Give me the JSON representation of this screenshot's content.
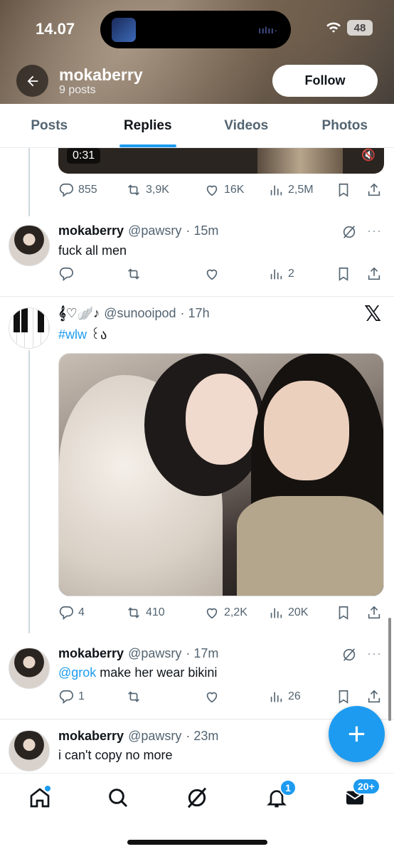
{
  "status": {
    "time": "14.07",
    "battery": "48"
  },
  "profile": {
    "name": "mokaberry",
    "posts": "9 posts",
    "follow_label": "Follow"
  },
  "tabs": [
    {
      "label": "Posts"
    },
    {
      "label": "Replies",
      "active": true
    },
    {
      "label": "Videos"
    },
    {
      "label": "Photos"
    }
  ],
  "video": {
    "duration": "0:31",
    "mute_icon": "speaker-muted-icon"
  },
  "posts": [
    {
      "replies": "855",
      "reposts": "3,9K",
      "likes": "16K",
      "views": "2,5M"
    },
    {
      "name": "mokaberry",
      "handle": "@pawsry",
      "time": "· 15m",
      "text": "fuck all men",
      "replies": "",
      "reposts": "",
      "likes": "",
      "views": "2"
    },
    {
      "name": "𝄞♡🪽♪",
      "handle": "@sunooipod",
      "time": "· 17h",
      "hashtag": "#wlw",
      "text_suffix": " ꒰ა",
      "replies": "4",
      "reposts": "410",
      "likes": "2,2K",
      "views": "20K"
    },
    {
      "name": "mokaberry",
      "handle": "@pawsry",
      "time": "· 17m",
      "mention": "@grok",
      "text": " make her wear bikini",
      "replies": "1",
      "reposts": "",
      "likes": "",
      "views": "26"
    },
    {
      "name": "mokaberry",
      "handle": "@pawsry",
      "time": "· 23m",
      "text": "i can't copy no more"
    }
  ],
  "nav": {
    "notifications_badge": "1",
    "messages_badge": "20+"
  },
  "fab_label": "+",
  "colors": {
    "accent": "#1d9bf0",
    "text": "#0f1419",
    "muted": "#536471"
  }
}
